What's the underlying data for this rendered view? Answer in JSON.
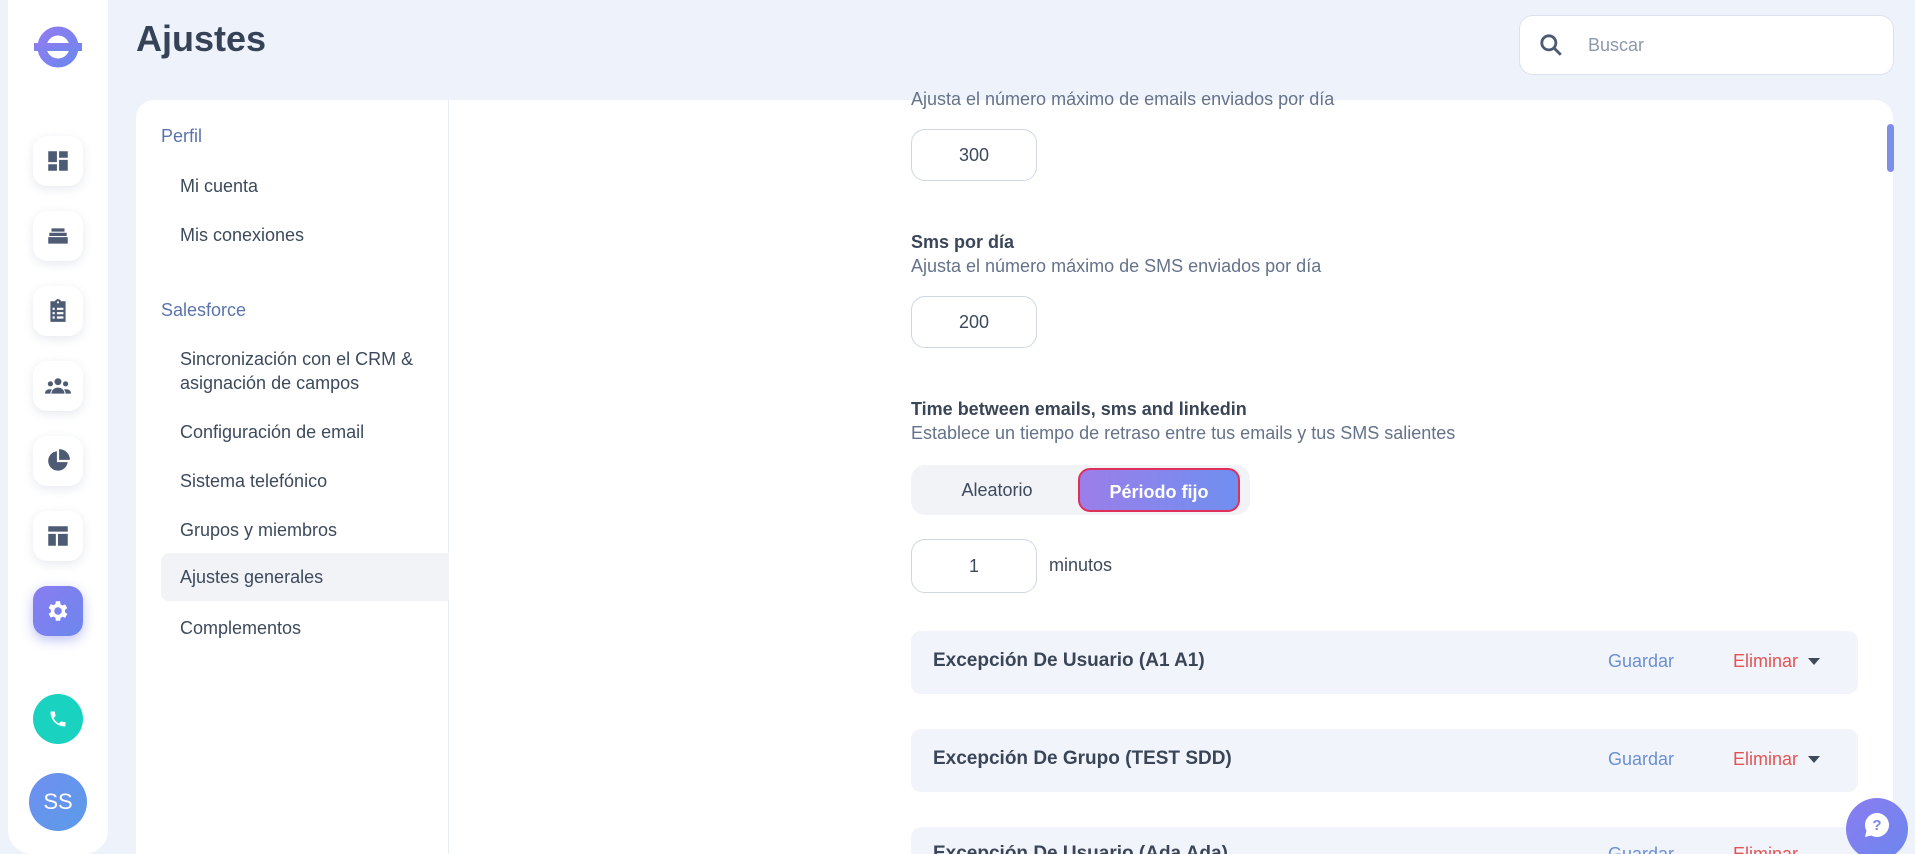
{
  "header": {
    "title": "Ajustes"
  },
  "search": {
    "placeholder": "Buscar"
  },
  "rail": {
    "icons": [
      "dashboard-icon",
      "inbox-icon",
      "clipboard-icon",
      "people-icon",
      "pie-chart-icon",
      "layout-icon",
      "settings-icon"
    ],
    "phone_icon": "phone-icon",
    "avatar_initials": "SS"
  },
  "subnav": {
    "sections": [
      {
        "title": "Perfil",
        "items": [
          "Mi cuenta",
          "Mis conexiones"
        ]
      },
      {
        "title": "Salesforce",
        "items": [
          "Sincronización con el CRM & asignación de campos",
          "Configuración de email",
          "Sistema telefónico",
          "Grupos y miembros",
          "Ajustes generales",
          "Complementos"
        ]
      }
    ],
    "active_item": "Ajustes generales"
  },
  "settings": {
    "emails": {
      "description": "Ajusta el número máximo de emails enviados por día",
      "value": "300"
    },
    "sms": {
      "title": "Sms por día",
      "description": "Ajusta el número máximo de SMS enviados por día",
      "value": "200"
    },
    "delay": {
      "title": "Time between emails, sms and linkedin",
      "description": "Establece un tiempo de retraso entre tus emails y tus SMS salientes",
      "options": [
        "Aleatorio",
        "Périodo fijo"
      ],
      "selected": "Périodo fijo",
      "value": "1",
      "unit": "minutos"
    },
    "exceptions": [
      {
        "title": "Excepción De Usuario (A1 A1)",
        "save": "Guardar",
        "delete": "Eliminar"
      },
      {
        "title": "Excepción De Grupo (TEST SDD)",
        "save": "Guardar",
        "delete": "Eliminar"
      },
      {
        "title": "Excepción De Usuario (Ada Ada)",
        "save": "Guardar",
        "delete": "Eliminar"
      }
    ]
  },
  "help_icon": "help-chat-icon",
  "colors": {
    "accent": "#7c86ee",
    "danger": "#e25454",
    "link": "#6a8fd0",
    "phone": "#19d3c0"
  }
}
